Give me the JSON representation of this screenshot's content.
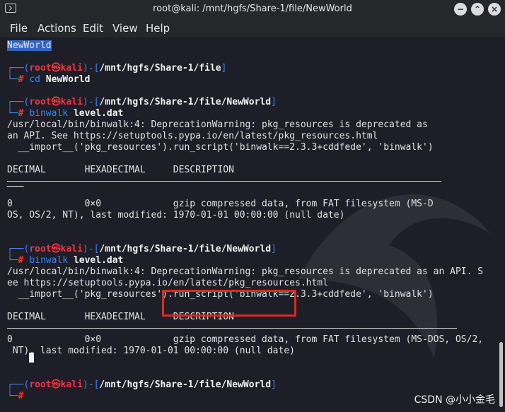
{
  "window": {
    "title": "root@kali: /mnt/hgfs/Share-1/file/NewWorld"
  },
  "menu": [
    "File",
    "Actions",
    "Edit",
    "View",
    "Help"
  ],
  "terminal": {
    "selected": "NewWorld",
    "p1": {
      "prefix": "┌──(",
      "user": "root㉿kali",
      "mid": ")-[",
      "path": "/mnt/hgfs/Share-1/file",
      "end": "]"
    },
    "c1": {
      "prefix": "└─",
      "hash": "#",
      "cmd": "cd",
      "arg": "NewWorld"
    },
    "p2": {
      "prefix": "┌──(",
      "user": "root㉿kali",
      "mid": ")-[",
      "path": "/mnt/hgfs/Share-1/file/NewWorld",
      "end": "]"
    },
    "c2": {
      "prefix": "└─",
      "hash": "#",
      "cmd": "binwalk",
      "arg": "level.dat"
    },
    "w1a": "/usr/local/bin/binwalk:4: DeprecationWarning: pkg_resources is deprecated as",
    "w1b": "an API. See https://setuptools.pypa.io/en/latest/pkg_resources.html",
    "w1c": "  __import__('pkg_resources').run_script('binwalk==2.3.3+cddfede', 'binwalk')",
    "hdr1": "DECIMAL       HEXADECIMAL     DESCRIPTION",
    "dash1": "───",
    "r1a": "0             0×0             gzip compressed data, from FAT filesystem (MS-D",
    "r1b": "OS, OS/2, NT), last modified: 1970-01-01 00:00:00 (null date)",
    "p3": {
      "prefix": "┌──(",
      "user": "root㉿kali",
      "mid": ")-[",
      "path": "/mnt/hgfs/Share-1/file/NewWorld",
      "end": "]"
    },
    "c3": {
      "prefix": "└─",
      "hash": "#",
      "cmd": "binwalk",
      "arg": "level.dat"
    },
    "w2a": "/usr/local/bin/binwalk:4: DeprecationWarning: pkg_resources is deprecated as an API. S",
    "w2b": "ee https://setuptools.pypa.io/en/latest/pkg_resources.html",
    "w2c": "  __import__('pkg_resources').run_script('binwalk==2.3.3+cddfede', 'binwalk')",
    "hdr2": "DECIMAL       HEXADECIMAL     DESCRIPTION",
    "r2a": "0             0×0             gzip compressed data, from FAT filesystem (MS-DOS, OS/2,",
    "r2b": " NT), last modified: 1970-01-01 00:00:00 (null date)",
    "p4": {
      "prefix": "┌──(",
      "user": "root㉿kali",
      "mid": ")-[",
      "path": "/mnt/hgfs/Share-1/file/NewWorld",
      "end": "]"
    },
    "c4": {
      "prefix": "└─",
      "hash": "#"
    }
  },
  "watermark": "CSDN @小小金毛",
  "colors": {
    "accent_blue": "#3b82f6",
    "root_red": "#f0353f",
    "highlight_box": "#e1281c"
  }
}
